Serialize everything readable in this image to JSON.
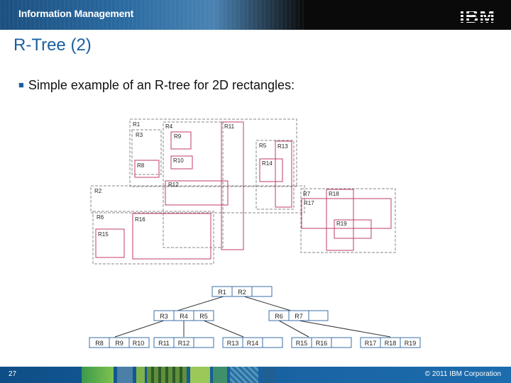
{
  "header": {
    "label": "Information Management",
    "logo": "IBM"
  },
  "slide": {
    "title": "R-Tree (2)",
    "bullet": "Simple example of an R-tree for 2D rectangles:"
  },
  "diagram": {
    "labels": [
      "R1",
      "R2",
      "R3",
      "R4",
      "R5",
      "R6",
      "R7",
      "R8",
      "R9",
      "R10",
      "R11",
      "R12",
      "R13",
      "R14",
      "R15",
      "R16",
      "R17",
      "R18",
      "R19"
    ],
    "tree": {
      "root": [
        "R1",
        "R2"
      ],
      "level1": [
        [
          "R3",
          "R4",
          "R5"
        ],
        [
          "R6",
          "R7"
        ]
      ],
      "leaves": [
        [
          "R8",
          "R9",
          "R10"
        ],
        [
          "R11",
          "R12"
        ],
        [
          "R13",
          "R14"
        ],
        [
          "R15",
          "R16"
        ],
        [
          "R17",
          "R18",
          "R19"
        ]
      ]
    }
  },
  "footer": {
    "page": "27",
    "copyright": "© 2011 IBM Corporation"
  },
  "colors": {
    "title": "#1a5fa0",
    "rect_solid": "#c23b6a",
    "rect_dashed": "#888888",
    "node_border": "#3a6fa8"
  }
}
